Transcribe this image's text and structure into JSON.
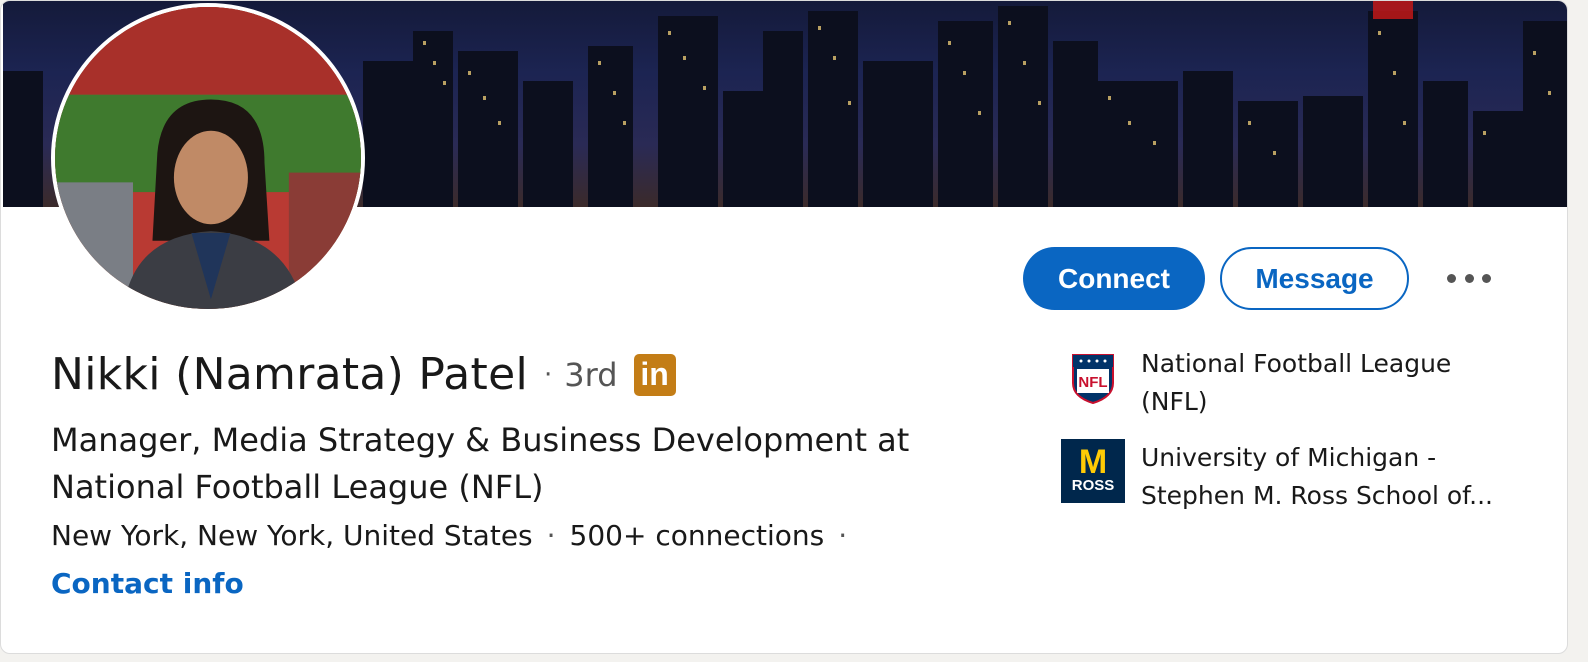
{
  "profile": {
    "name": "Nikki (Namrata) Patel",
    "separator": "·",
    "degree": "3rd",
    "badge": "in",
    "headline": "Manager, Media Strategy & Business Development at National Football League (NFL)",
    "location": "New York, New York, United States",
    "dot": "·",
    "connections": "500+ connections",
    "contact_info": "Contact info"
  },
  "actions": {
    "connect_label": "Connect",
    "message_label": "Message"
  },
  "organizations": [
    {
      "name": "National Football League (NFL)",
      "logo": "nfl-logo",
      "logo_text": "NFL"
    },
    {
      "name": "University of Michigan - Stephen M. Ross School of...",
      "logo": "ross-logo",
      "logo_text_top": "M",
      "logo_text_bottom": "ROSS"
    }
  ],
  "colors": {
    "brand_blue": "#0a66c2",
    "badge_gold": "#c37d16"
  }
}
